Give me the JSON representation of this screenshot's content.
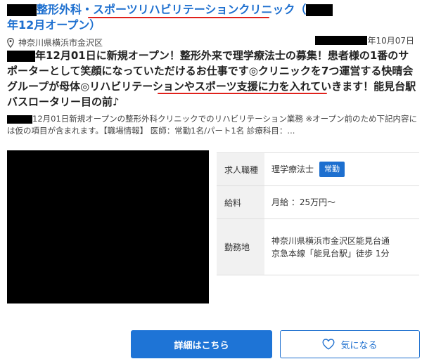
{
  "title": {
    "part1": "整形外科・",
    "part2": "スポーツリハビリテーションクリニック",
    "part3": "（",
    "line2": "年12月オープン）"
  },
  "location": {
    "text": "神奈川県横浜市金沢区",
    "icon": "map-pin-icon"
  },
  "date": {
    "text": "年10月07日"
  },
  "headline": {
    "a": "年12月01日に新規オープン！整形外来で理学療法士の募集！患者様の1番のサポーターとして笑顔になっていただけるお仕事です◎クリニックを7つ運営する快晴会グループが母体◎リハビリテーションや",
    "b": "スポーツ支援に力を入れていきます！",
    "c": "能見台駅バスロータリー目の前♪"
  },
  "summary": {
    "text": "12月01日新規オープンの整形外科クリニックでのリハビリテーション業務 ※オープン前のため下記内容には仮の項目が含まれます。【職場情報】 医師：常勤1名/パート1名 診療科目：..."
  },
  "info": {
    "job_label": "求人職種",
    "job_value": "理学療法士",
    "job_badge": "常勤",
    "salary_label": "給料",
    "salary_value": "月給 ：25万円〜",
    "place_label": "勤務地",
    "place_line1": "神奈川県横浜市金沢区能見台通",
    "place_line2": "京急本線「能見台駅」徒歩 1分"
  },
  "buttons": {
    "detail": "詳細はこちら",
    "favorite": "気になる",
    "favorite_icon": "heart-icon"
  },
  "colors": {
    "accent": "#1d6fcf",
    "underline": "#e0211b",
    "button": "#1e74d6"
  }
}
